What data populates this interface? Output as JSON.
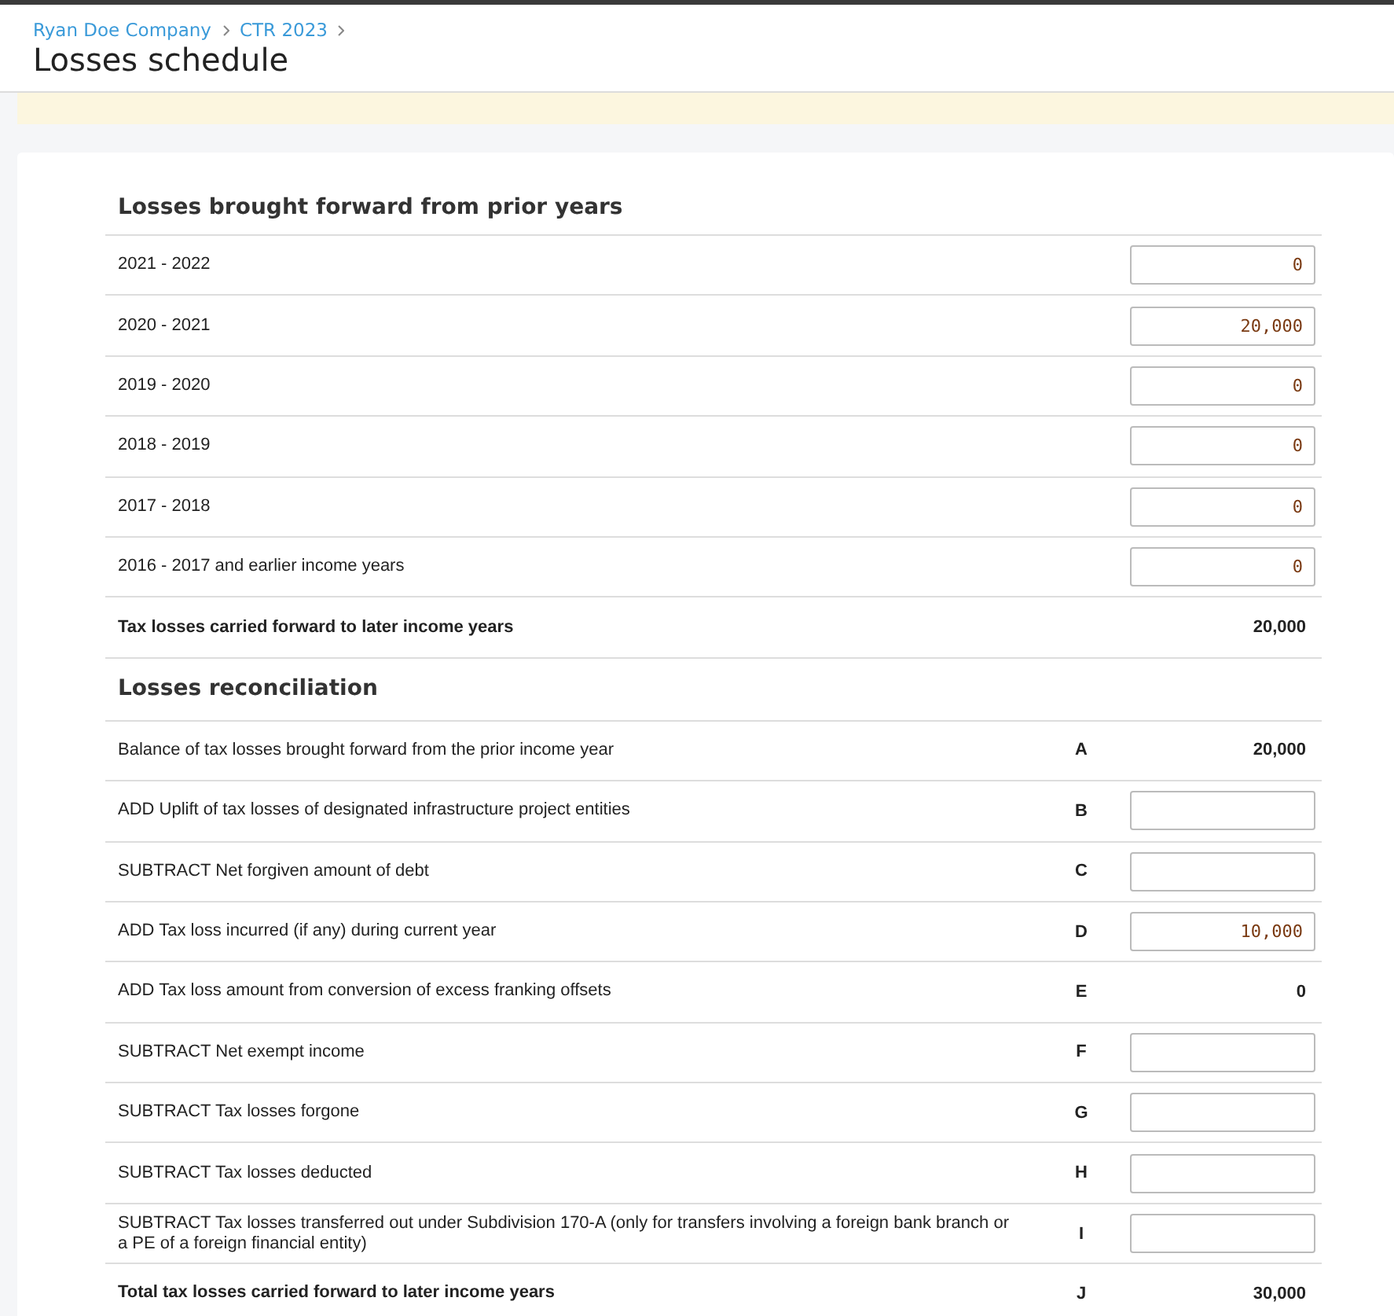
{
  "breadcrumbs": [
    "Ryan Doe Company",
    "CTR 2023"
  ],
  "page_title": "Losses schedule",
  "sections": [
    {
      "title": "Losses brought forward from prior years",
      "rows": [
        {
          "kind": "input",
          "label": "2021 - 2022",
          "value": "0"
        },
        {
          "kind": "input",
          "label": "2020 - 2021",
          "value": "20,000"
        },
        {
          "kind": "input",
          "label": "2019 - 2020",
          "value": "0"
        },
        {
          "kind": "input",
          "label": "2018 - 2019",
          "value": "0"
        },
        {
          "kind": "input",
          "label": "2017 - 2018",
          "value": "0"
        },
        {
          "kind": "input",
          "label": "2016 - 2017 and earlier income years",
          "value": "0"
        },
        {
          "kind": "total",
          "label": "Tax losses carried forward to later income years",
          "value": "20,000"
        }
      ]
    },
    {
      "title": "Losses reconciliation",
      "rows": [
        {
          "kind": "value",
          "label": "Balance of tax losses brought forward from the prior income year",
          "code": "A",
          "value": "20,000"
        },
        {
          "kind": "input",
          "label": "ADD Uplift of tax losses of designated infrastructure project entities",
          "code": "B"
        },
        {
          "kind": "input",
          "label": "SUBTRACT Net forgiven amount of debt",
          "code": "C"
        },
        {
          "kind": "input",
          "label": "ADD Tax loss incurred (if any) during current year",
          "code": "D",
          "value": "10,000"
        },
        {
          "kind": "value",
          "label": "ADD Tax loss amount from conversion of excess franking offsets",
          "code": "E",
          "value": "0"
        },
        {
          "kind": "input",
          "label": "SUBTRACT Net exempt income",
          "code": "F"
        },
        {
          "kind": "input",
          "label": "SUBTRACT Tax losses forgone",
          "code": "G"
        },
        {
          "kind": "input",
          "label": "SUBTRACT Tax losses deducted",
          "code": "H"
        },
        {
          "kind": "input",
          "label": "SUBTRACT Tax losses transferred out under Subdivision 170-A (only for transfers involving a foreign bank branch or a PE of a foreign financial entity)",
          "code": "I"
        },
        {
          "kind": "total",
          "label": "Total tax losses carried forward to later income years",
          "code": "J",
          "value": "30,000"
        }
      ]
    }
  ]
}
